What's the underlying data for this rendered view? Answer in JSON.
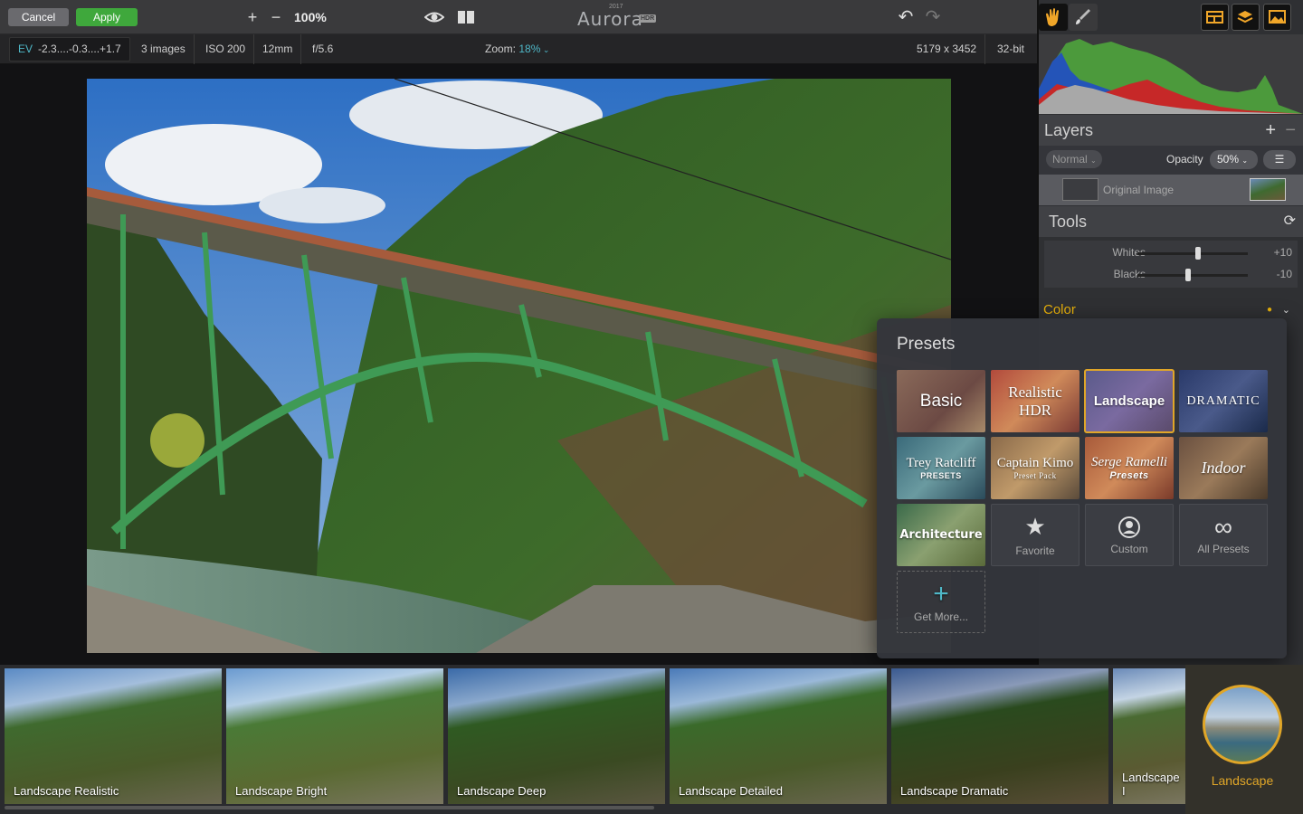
{
  "toolbar": {
    "cancel": "Cancel",
    "apply": "Apply",
    "zoom": "100%",
    "app_name": "Aurora",
    "app_year": "2017",
    "app_badge": "HDR"
  },
  "infobar": {
    "ev_label": "EV",
    "ev_value": "-2.3....-0.3....+1.7",
    "images": "3 images",
    "iso": "ISO 200",
    "focal": "12mm",
    "aperture": "f/5.6",
    "zoom_label": "Zoom:",
    "zoom_value": "18%",
    "dimensions": "5179 x 3452",
    "bitdepth": "32-bit"
  },
  "layers": {
    "title": "Layers",
    "blend_mode": "Normal",
    "opacity_label": "Opacity",
    "opacity_value": "50%",
    "layer_name": "Original Image"
  },
  "tools": {
    "title": "Tools",
    "sliders": [
      {
        "label": "Whites",
        "value": "+10",
        "position": 0.55
      },
      {
        "label": "Blacks",
        "value": "-10",
        "position": 0.45
      }
    ]
  },
  "color_section": {
    "title": "Color",
    "accent": "#e8b10b"
  },
  "presets": {
    "title": "Presets",
    "tiles": [
      {
        "label": "Basic",
        "sub": ""
      },
      {
        "label": "Realistic HDR",
        "sub": ""
      },
      {
        "label": "Landscape",
        "sub": ""
      },
      {
        "label": "DRAMATIC",
        "sub": ""
      },
      {
        "label": "Trey Ratcliff",
        "sub": "PRESETS"
      },
      {
        "label": "Captain Kimo",
        "sub": "Preset Pack"
      },
      {
        "label": "Serge Ramelli",
        "sub": "Presets"
      },
      {
        "label": "Indoor",
        "sub": ""
      },
      {
        "label": "Architecture",
        "sub": ""
      },
      {
        "label": "Favorite",
        "sub": ""
      },
      {
        "label": "Custom",
        "sub": ""
      },
      {
        "label": "All Presets",
        "sub": ""
      },
      {
        "label": "Get More...",
        "sub": ""
      }
    ]
  },
  "filmstrip": {
    "items": [
      "Landscape Realistic",
      "Landscape Bright",
      "Landscape Deep",
      "Landscape Detailed",
      "Landscape Dramatic",
      "Landscape I"
    ],
    "current": "Landscape"
  }
}
